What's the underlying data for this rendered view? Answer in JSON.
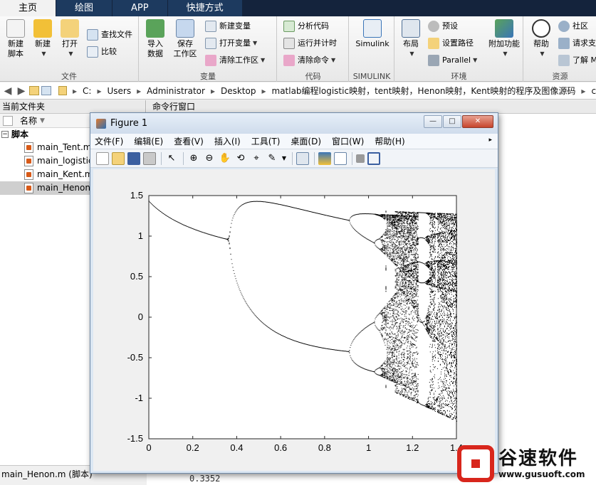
{
  "tabs": [
    {
      "label": "主页",
      "active": true
    },
    {
      "label": "绘图",
      "active": false
    },
    {
      "label": "APP",
      "active": false
    },
    {
      "label": "快捷方式",
      "active": false
    }
  ],
  "ribbon": {
    "file_group": {
      "label": "文件",
      "new_script": "新建\n脚本",
      "new": "新建",
      "open": "打开",
      "find_files": "查找文件",
      "compare": "比较"
    },
    "variable_group": {
      "label": "变量",
      "import_data": "导入\n数据",
      "save_workspace": "保存\n工作区",
      "new_variable": "新建变量",
      "open_variable": "打开变量",
      "clear_workspace": "清除工作区"
    },
    "code_group": {
      "label": "代码",
      "analyze_code": "分析代码",
      "run_and_time": "运行并计时",
      "clear_commands": "清除命令"
    },
    "simulink_group": {
      "label": "SIMULINK",
      "simulink": "Simulink"
    },
    "environment_group": {
      "label": "环境",
      "layout": "布局",
      "preferences": "预设",
      "set_path": "设置路径",
      "parallel": "Parallel",
      "add_ons": "附加功能"
    },
    "resources_group": {
      "label": "资源",
      "help": "帮助",
      "community": "社区",
      "request_support": "请求支",
      "learn": "了解 M"
    }
  },
  "address": {
    "crumbs": [
      "C:",
      "Users",
      "Administrator",
      "Desktop",
      "matlab编程logistic映射，tent映射，Henon映射，Kent映射的程序及图像源码",
      "c"
    ]
  },
  "left_panel": {
    "title": "当前文件夹",
    "column_name": "名称",
    "group": "脚本",
    "files": [
      {
        "name": "main_Tent.m",
        "selected": false
      },
      {
        "name": "main_logistic.m",
        "selected": false
      },
      {
        "name": "main_Kent.m",
        "selected": false
      },
      {
        "name": "main_Henon.m",
        "selected": true
      }
    ],
    "status": "main_Henon.m (脚本)"
  },
  "command_window": {
    "title": "命令行窗口",
    "bottom_text": "0.3352"
  },
  "figure": {
    "title": "Figure 1",
    "menu": [
      "文件(F)",
      "编辑(E)",
      "查看(V)",
      "插入(I)",
      "工具(T)",
      "桌面(D)",
      "窗口(W)",
      "帮助(H)"
    ]
  },
  "chart_data": {
    "type": "scatter",
    "title": "",
    "xlabel": "",
    "ylabel": "",
    "xlim": [
      0,
      1.4
    ],
    "ylim": [
      -1.5,
      1.5
    ],
    "xticks": [
      0,
      0.2,
      0.4,
      0.6,
      0.8,
      1,
      1.2,
      1.4
    ],
    "yticks": [
      -1.5,
      -1,
      -0.5,
      0,
      0.5,
      1,
      1.5
    ],
    "grid": false,
    "series": [
      {
        "name": "",
        "generator": "henon",
        "b": 0.3,
        "a_min": 0.0,
        "a_max": 1.4,
        "color": "#000000"
      }
    ]
  },
  "watermark": {
    "title": "谷速软件",
    "url": "www.gusuoft.com",
    "color": "#d8261c"
  }
}
